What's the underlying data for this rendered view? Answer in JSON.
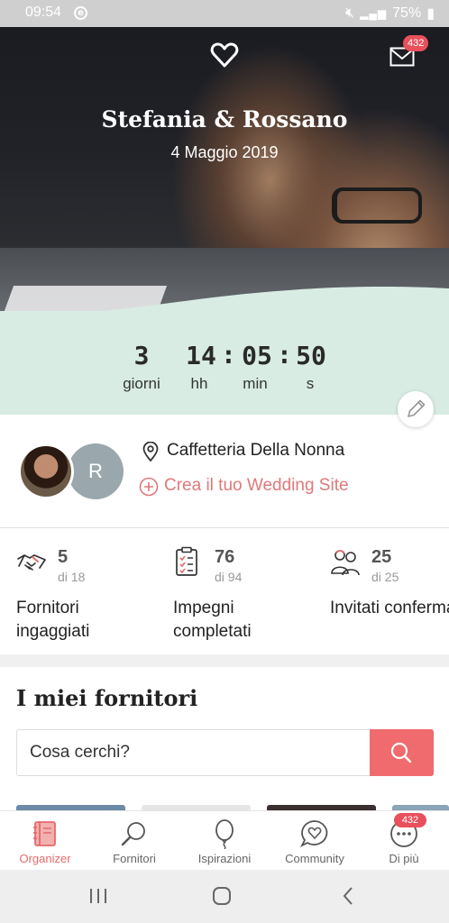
{
  "status_bar": {
    "time": "09:54",
    "battery": "75%"
  },
  "hero": {
    "couple_names": "Stefania & Rossano",
    "wedding_date": "4 Maggio 2019",
    "messages_badge": "432"
  },
  "countdown": {
    "days": "3",
    "hours": "14",
    "minutes": "05",
    "seconds": "50",
    "days_label": "giorni",
    "hours_label": "hh",
    "minutes_label": "min",
    "seconds_label": "s"
  },
  "info": {
    "avatar_initial": "R",
    "venue": "Caffetteria Della Nonna",
    "wedding_site_link": "Crea il tuo Wedding Site"
  },
  "stats": [
    {
      "icon": "handshake-icon",
      "value": "5",
      "total": "di 18",
      "label": "Fornitori ingaggiati"
    },
    {
      "icon": "checklist-icon",
      "value": "76",
      "total": "di 94",
      "label": "Impegni completati"
    },
    {
      "icon": "guests-icon",
      "value": "25",
      "total": "di 25",
      "label": "Invitati confermati"
    }
  ],
  "vendors": {
    "title": "I miei fornitori",
    "search_placeholder": "Cosa cerchi?"
  },
  "bottom_nav": {
    "items": [
      {
        "label": "Organizer",
        "icon": "organizer-icon",
        "active": true
      },
      {
        "label": "Fornitori",
        "icon": "search-icon",
        "active": false
      },
      {
        "label": "Ispirazioni",
        "icon": "balloon-icon",
        "active": false
      },
      {
        "label": "Community",
        "icon": "chat-heart-icon",
        "active": false
      },
      {
        "label": "Di più",
        "icon": "more-icon",
        "active": false
      }
    ],
    "more_badge": "432"
  },
  "colors": {
    "accent": "#f06b6d",
    "mint": "#d8ece4",
    "badge": "#e8505b"
  }
}
